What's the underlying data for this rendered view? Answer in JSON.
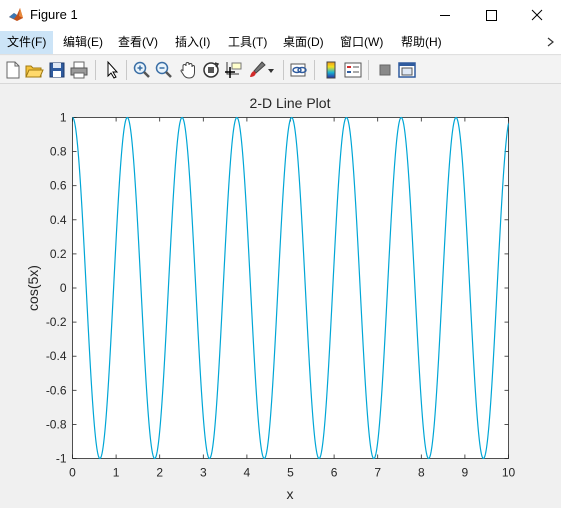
{
  "window": {
    "title": "Figure 1",
    "controls": {
      "minimize": "minimize",
      "maximize": "maximize",
      "close": "close"
    }
  },
  "menu": {
    "items": [
      {
        "label": "文件(F)",
        "active": true
      },
      {
        "label": "编辑(E)"
      },
      {
        "label": "查看(V)"
      },
      {
        "label": "插入(I)"
      },
      {
        "label": "工具(T)"
      },
      {
        "label": "桌面(D)"
      },
      {
        "label": "窗口(W)"
      },
      {
        "label": "帮助(H)"
      }
    ]
  },
  "toolbar": {
    "icons": [
      "new-figure-icon",
      "open-file-icon",
      "save-icon",
      "print-icon",
      "edit-plot-arrow-icon",
      "zoom-in-icon",
      "zoom-out-icon",
      "pan-hand-icon",
      "rotate-3d-icon",
      "data-cursor-icon",
      "brush-icon",
      "brush-dropdown-icon",
      "link-plot-icon",
      "colorbar-icon",
      "legend-icon",
      "hide-plot-tools-icon",
      "show-plot-tools-icon"
    ]
  },
  "chart_data": {
    "type": "line",
    "title": "2-D Line Plot",
    "xlabel": "x",
    "ylabel": "cos(5x)",
    "xlim": [
      0,
      10
    ],
    "ylim": [
      -1,
      1
    ],
    "xticks": [
      0,
      1,
      2,
      3,
      4,
      5,
      6,
      7,
      8,
      9,
      10
    ],
    "yticks": [
      -1,
      -0.8,
      -0.6,
      -0.4,
      -0.2,
      0,
      0.2,
      0.4,
      0.6,
      0.8,
      1
    ],
    "grid": false,
    "series": [
      {
        "function": "cos(5x)",
        "x_range": [
          0,
          10
        ],
        "color": "#00a6d6"
      }
    ]
  },
  "colors": {
    "line": "#00a6d6",
    "axes_bg": "#ffffff",
    "figure_bg": "#f0f0f0",
    "axis": "#262626"
  }
}
